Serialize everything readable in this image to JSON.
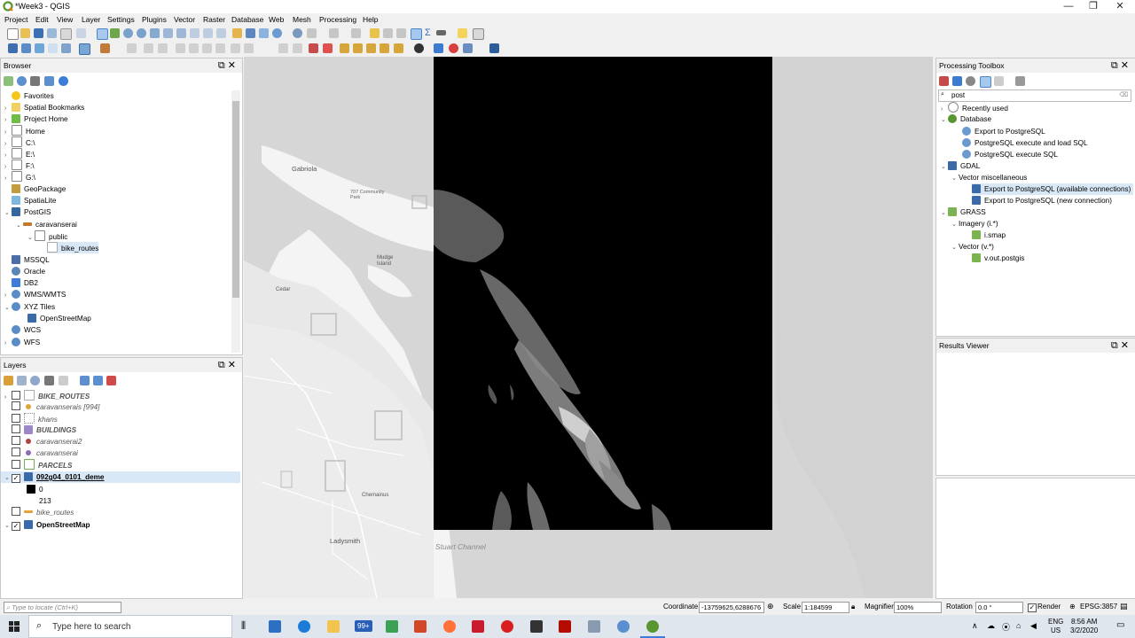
{
  "window": {
    "title": "*Week3 - QGIS",
    "controls": [
      "—",
      "❐",
      "✕"
    ]
  },
  "menu": [
    "Project",
    "Edit",
    "View",
    "Layer",
    "Settings",
    "Plugins",
    "Vector",
    "Raster",
    "Database",
    "Web",
    "Mesh",
    "Processing",
    "Help"
  ],
  "browser": {
    "title": "Browser",
    "items": [
      {
        "label": "Favorites",
        "icon": "star-icon"
      },
      {
        "label": "Spatial Bookmarks",
        "icon": "bookmark-icon"
      },
      {
        "label": "Project Home",
        "icon": "project-home-icon"
      },
      {
        "label": "Home",
        "icon": "folder-icon"
      },
      {
        "label": "C:\\",
        "icon": "drive-icon"
      },
      {
        "label": "E:\\",
        "icon": "drive-icon"
      },
      {
        "label": "F:\\",
        "icon": "drive-icon"
      },
      {
        "label": "G:\\",
        "icon": "drive-icon"
      },
      {
        "label": "GeoPackage",
        "icon": "geopackage-icon"
      },
      {
        "label": "SpatiaLite",
        "icon": "spatialite-icon"
      },
      {
        "label": "PostGIS",
        "icon": "postgis-icon"
      },
      {
        "label": "caravanserai",
        "icon": "connection-icon"
      },
      {
        "label": "public",
        "icon": "schema-icon"
      },
      {
        "label": "bike_routes",
        "icon": "line-layer-icon"
      },
      {
        "label": "MSSQL",
        "icon": "mssql-icon"
      },
      {
        "label": "Oracle",
        "icon": "oracle-icon"
      },
      {
        "label": "DB2",
        "icon": "db2-icon"
      },
      {
        "label": "WMS/WMTS",
        "icon": "globe-icon"
      },
      {
        "label": "XYZ Tiles",
        "icon": "globe-icon"
      },
      {
        "label": "OpenStreetMap",
        "icon": "tiles-icon"
      },
      {
        "label": "WCS",
        "icon": "globe-icon"
      },
      {
        "label": "WFS",
        "icon": "globe-icon"
      }
    ]
  },
  "layers": {
    "title": "Layers",
    "items": [
      {
        "label": "BIKE_ROUTES",
        "checked": false,
        "italic": true
      },
      {
        "label": "caravanserais [994]",
        "checked": false,
        "italic": true
      },
      {
        "label": "khans",
        "checked": false,
        "italic": true
      },
      {
        "label": "BUILDINGS",
        "checked": false,
        "italic": true
      },
      {
        "label": "caravanserai2",
        "checked": false,
        "italic": true
      },
      {
        "label": "caravanserai",
        "checked": false,
        "italic": true
      },
      {
        "label": "PARCELS",
        "checked": false,
        "italic": true
      },
      {
        "label": "092g04_0101_deme",
        "checked": true,
        "bold": true
      },
      {
        "label": "0",
        "legend": true
      },
      {
        "label": "213",
        "legend": true
      },
      {
        "label": "bike_routes",
        "checked": false,
        "italic": true
      },
      {
        "label": "OpenStreetMap",
        "checked": true,
        "bold": true
      }
    ]
  },
  "toolbox": {
    "title": "Processing Toolbox",
    "search": "post",
    "items": [
      {
        "label": "Recently used"
      },
      {
        "label": "Database"
      },
      {
        "label": "Export to PostgreSQL"
      },
      {
        "label": "PostgreSQL execute and load SQL"
      },
      {
        "label": "PostgreSQL execute SQL"
      },
      {
        "label": "GDAL"
      },
      {
        "label": "Vector miscellaneous"
      },
      {
        "label": "Export to PostgreSQL (available connections)"
      },
      {
        "label": "Export to PostgreSQL (new connection)"
      },
      {
        "label": "GRASS"
      },
      {
        "label": "Imagery (i.*)"
      },
      {
        "label": "i.smap"
      },
      {
        "label": "Vector (v.*)"
      },
      {
        "label": "v.out.postgis"
      }
    ]
  },
  "results": {
    "title": "Results Viewer"
  },
  "map_labels": {
    "gabriola": "Gabriola",
    "park": "707 Community Park",
    "mudge": "Mudge Island",
    "cedar": "Cedar",
    "chemainus": "Chemainus",
    "ladysmith": "Ladysmith",
    "stuart": "Stuart Channel"
  },
  "status": {
    "locate_placeholder": "Type to locate (Ctrl+K)",
    "coordinate_label": "Coordinate",
    "coordinate": "-13759625,6288676",
    "scale_label": "Scale",
    "scale": "1:184599",
    "magnifier_label": "Magnifier",
    "magnifier": "100%",
    "rotation_label": "Rotation",
    "rotation": "0.0 °",
    "render_label": "Render",
    "crs": "EPSG:3857"
  },
  "taskbar": {
    "search_placeholder": "Type here to search",
    "badge": "99+",
    "lang": "ENG",
    "region": "US",
    "time": "8:56 AM",
    "date": "3/2/2020"
  }
}
